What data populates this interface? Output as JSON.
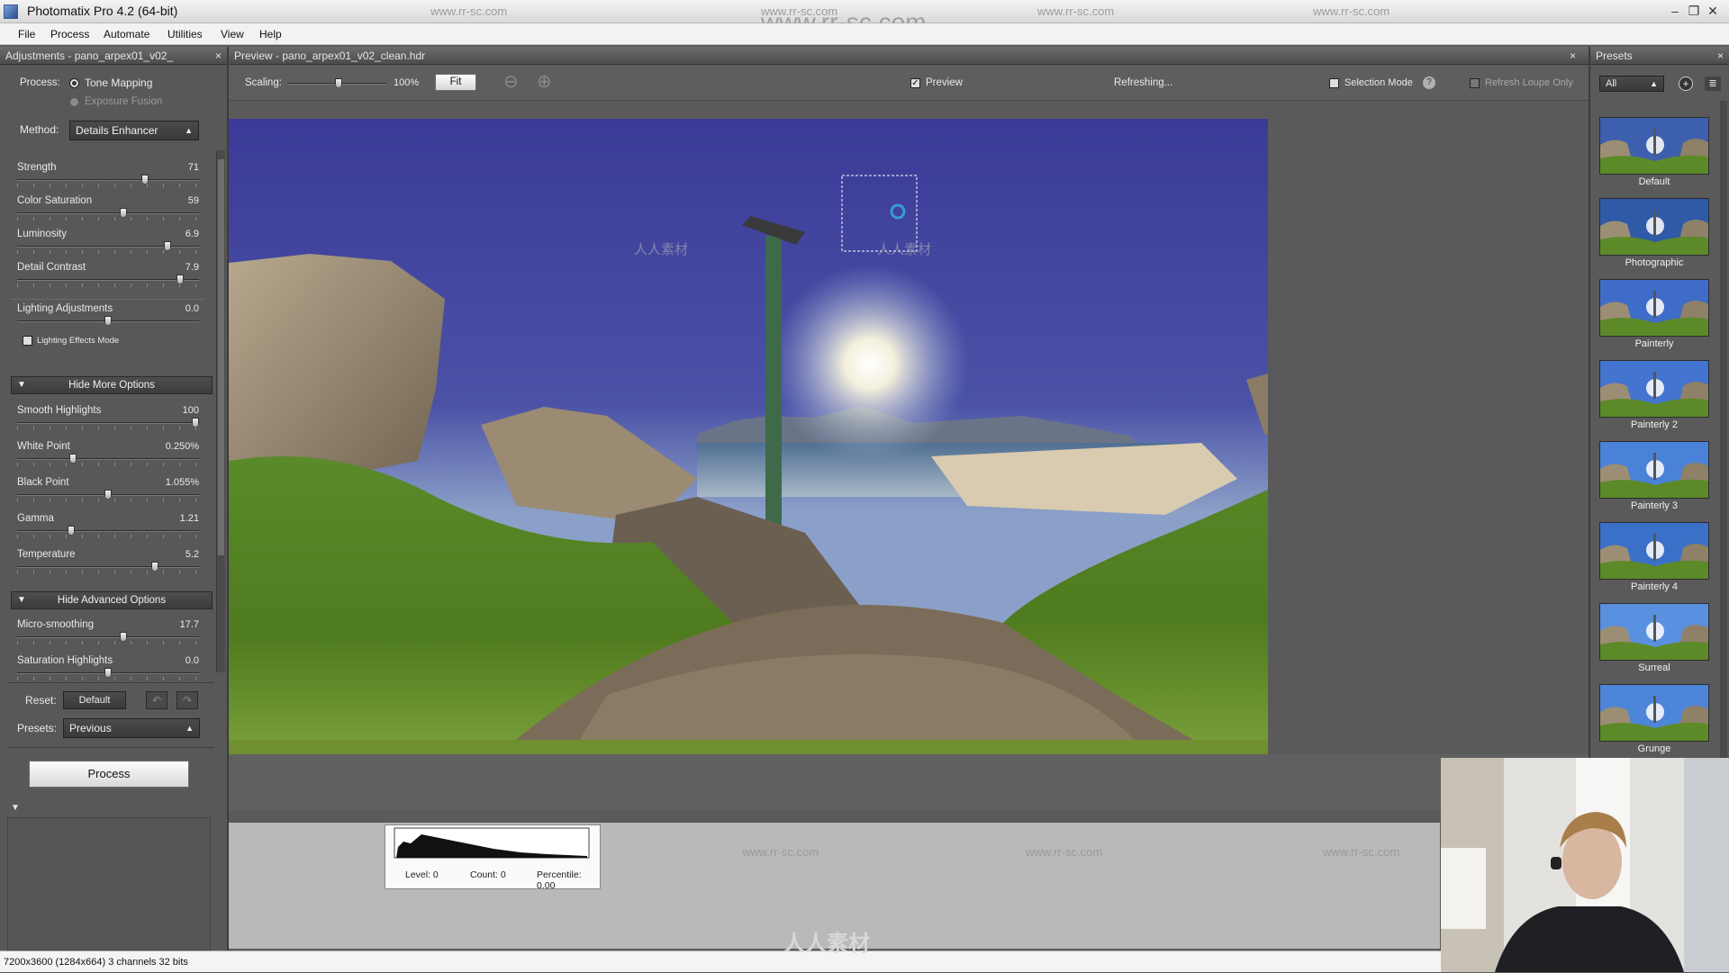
{
  "window": {
    "title": "Photomatix Pro 4.2 (64-bit)",
    "watermark": "www.rr-sc.com",
    "controls": [
      "–",
      "❐",
      "✕"
    ]
  },
  "menu": [
    "File",
    "Process",
    "Automate",
    "Utilities",
    "View",
    "Help"
  ],
  "left": {
    "header": "Adjustments - pano_arpex01_v02_",
    "close": "×",
    "process_label": "Process:",
    "process_options": [
      "Tone Mapping",
      "Exposure Fusion"
    ],
    "process_selected": "Tone Mapping",
    "method_label": "Method:",
    "method_value": "Details Enhancer",
    "sliders": [
      {
        "label": "Strength",
        "value": "71",
        "level": 0.71
      },
      {
        "label": "Color Saturation",
        "value": "59",
        "level": 0.59
      },
      {
        "label": "Luminosity",
        "value": "6.9",
        "level": 0.84
      },
      {
        "label": "Detail Contrast",
        "value": "7.9",
        "level": 0.91
      }
    ],
    "lighting": {
      "label": "Lighting Adjustments",
      "value": "0.0",
      "level": 0.5,
      "effects_mode": "Lighting Effects Mode"
    },
    "more_options": {
      "toggle": "Hide More Options",
      "sliders": [
        {
          "label": "Smooth Highlights",
          "value": "100",
          "level": 1.0
        },
        {
          "label": "White Point",
          "value": "0.250%",
          "level": 0.3
        },
        {
          "label": "Black Point",
          "value": "1.055%",
          "level": 0.5
        },
        {
          "label": "Gamma",
          "value": "1.21",
          "level": 0.29
        },
        {
          "label": "Temperature",
          "value": "5.2",
          "level": 0.77
        }
      ]
    },
    "advanced_options": {
      "toggle": "Hide Advanced Options",
      "sliders": [
        {
          "label": "Micro-smoothing",
          "value": "17.7",
          "level": 0.59
        },
        {
          "label": "Saturation Highlights",
          "value": "0.0",
          "level": 0.5
        }
      ]
    },
    "reset_label": "Reset:",
    "reset_default": "Default",
    "presets_label": "Presets:",
    "presets_value": "Previous",
    "process_button": "Process"
  },
  "preview": {
    "header": "Preview - pano_arpex01_v02_clean.hdr",
    "close": "×",
    "scaling_label": "Scaling:",
    "scaling_value": "100%",
    "scaling_level": 0.5,
    "fit_button": "Fit",
    "preview_checkbox": "Preview",
    "status": "Refreshing...",
    "selection_mode": "Selection Mode",
    "help": "?",
    "refresh_loupe": "Refresh Loupe Only"
  },
  "histogram": {
    "level": "Level: 0",
    "count": "Count: 0",
    "percentile": "Percentile: 0.00"
  },
  "presets": {
    "header": "Presets",
    "close": "×",
    "filter": "All",
    "items": [
      "Default",
      "Photographic",
      "Painterly",
      "Painterly 2",
      "Painterly 3",
      "Painterly 4",
      "Surreal",
      "Grunge"
    ]
  },
  "status": "7200x3600 (1284x664) 3 channels 32 bits",
  "colors": {
    "panel": "#585858",
    "header": "#4c4c4c",
    "sky": "#3e3f9a",
    "grass": "#4a7a22"
  }
}
